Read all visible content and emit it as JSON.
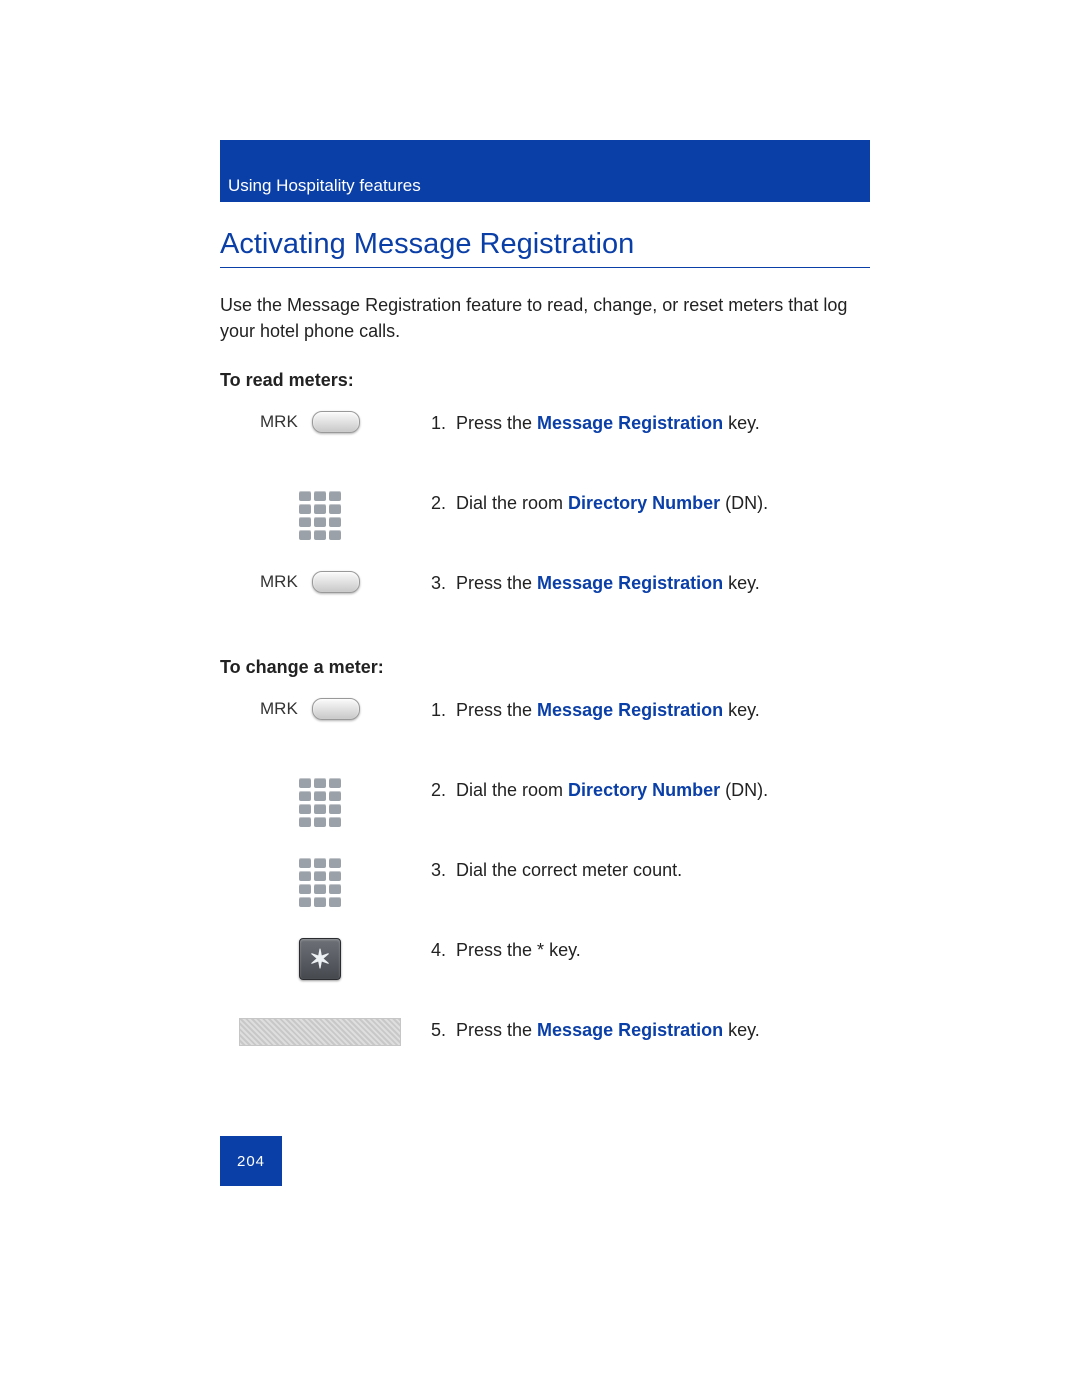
{
  "header": {
    "section": "Using Hospitality features"
  },
  "title": "Activating Message Registration",
  "intro": "Use the Message Registration feature to read, change, or reset meters that log your hotel phone calls.",
  "subheads": {
    "read": "To read meters:",
    "change": "To change a meter:"
  },
  "labels": {
    "mrk": "MRK"
  },
  "terms": {
    "msgreg": "Message Registration",
    "dirnum": "Directory Number"
  },
  "steps_read": [
    {
      "n": "1.",
      "pre": "Press the ",
      "bold_key": "msgreg",
      "post": " key."
    },
    {
      "n": "2.",
      "pre": "Dial the room ",
      "bold_key": "dirnum",
      "post": " (DN)."
    },
    {
      "n": "3.",
      "pre": "Press the ",
      "bold_key": "msgreg",
      "post": " key."
    }
  ],
  "steps_change": [
    {
      "n": "1.",
      "pre": "Press the ",
      "bold_key": "msgreg",
      "post": " key."
    },
    {
      "n": "2.",
      "pre": "Dial the room ",
      "bold_key": "dirnum",
      "post": " (DN)."
    },
    {
      "n": "3.",
      "text": "Dial the correct meter count."
    },
    {
      "n": "4.",
      "pre": "Press the ",
      "plain_bold": "*",
      "post": " key.",
      "star": true
    },
    {
      "n": "5.",
      "pre": "Press the ",
      "bold_key": "msgreg",
      "post": " key."
    }
  ],
  "page_number": "204"
}
